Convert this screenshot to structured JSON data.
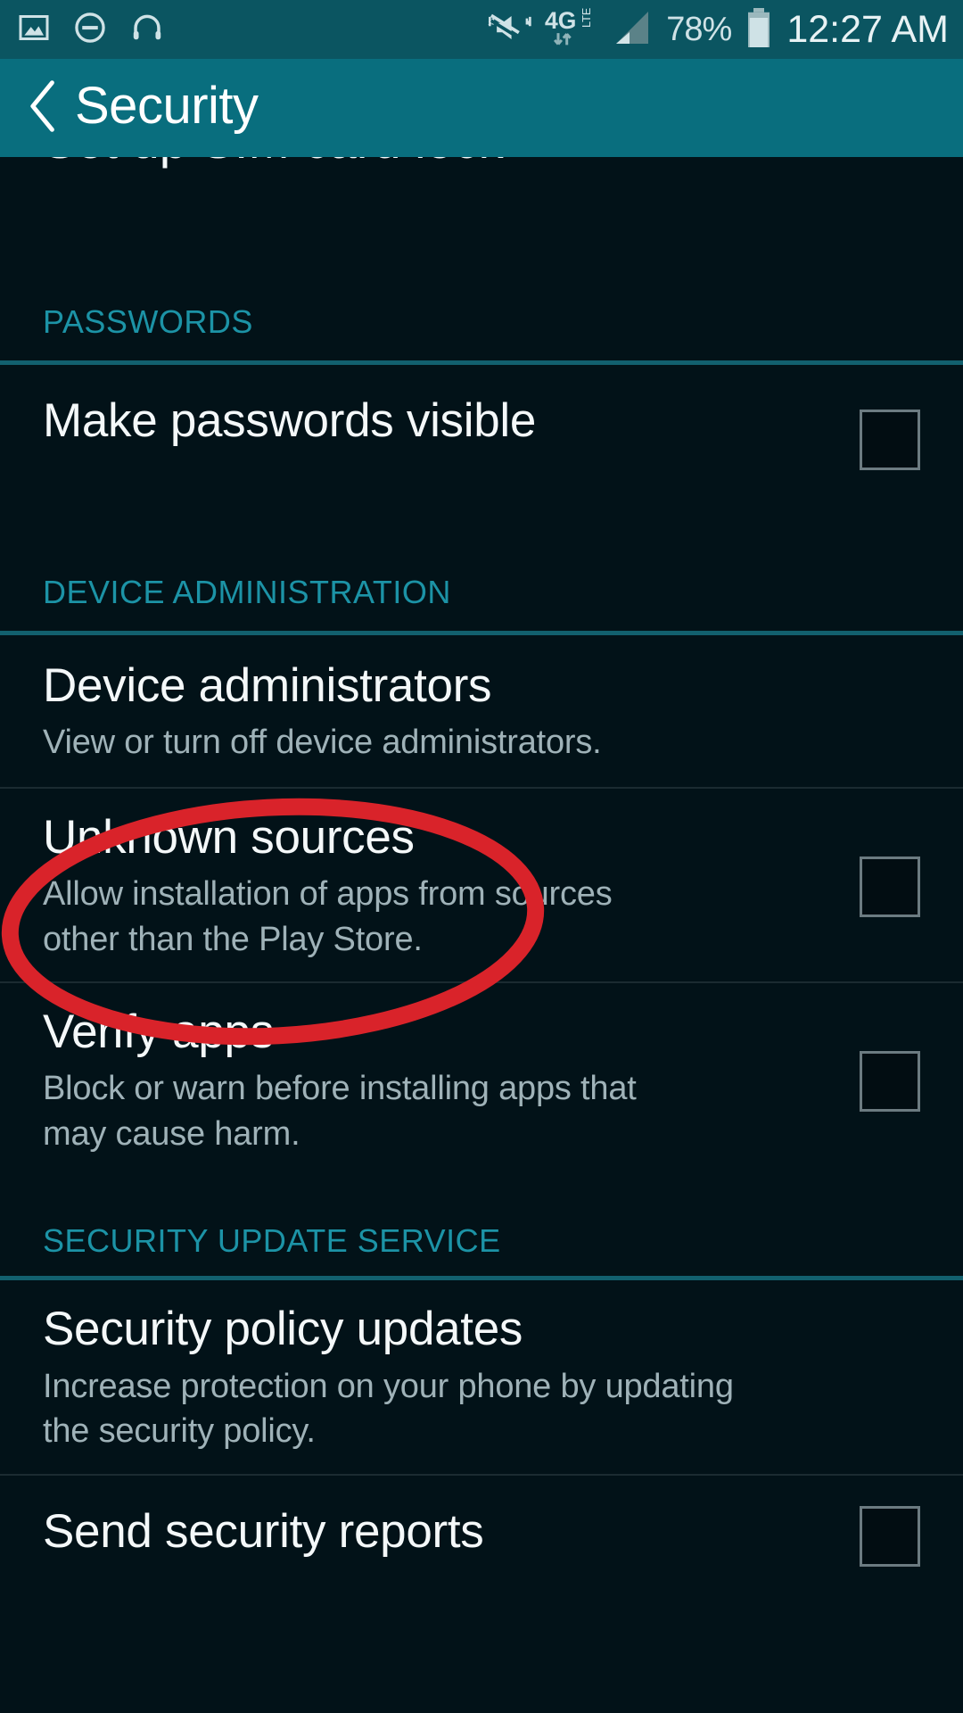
{
  "status_bar": {
    "icons_left": [
      "image-icon",
      "do-not-disturb-icon",
      "headphones-icon"
    ],
    "icons_right": [
      "mute-vibrate-icon",
      "4g-lte-icon",
      "signal-bars-icon"
    ],
    "network_label": "4G",
    "network_sub_label": "LTE",
    "battery_percent": "78%",
    "time": "12:27 AM"
  },
  "app_bar": {
    "back_icon": "chevron-left-icon",
    "title": "Security"
  },
  "list": {
    "clipped_top_item": {
      "title": "Set up SIM card lock"
    },
    "sections": [
      {
        "header": "PASSWORDS",
        "items": [
          {
            "title": "Make passwords visible",
            "subtitle": "",
            "control": "checkbox",
            "checked": false
          }
        ]
      },
      {
        "header": "DEVICE ADMINISTRATION",
        "items": [
          {
            "title": "Device administrators",
            "subtitle": "View or turn off device administrators.",
            "control": "none",
            "checked": false
          },
          {
            "title": "Unknown sources",
            "subtitle": "Allow installation of apps from sources other than the Play Store.",
            "control": "checkbox",
            "checked": false
          },
          {
            "title": "Verify apps",
            "subtitle": "Block or warn before installing apps that may cause harm.",
            "control": "checkbox",
            "checked": false
          }
        ]
      },
      {
        "header": "SECURITY UPDATE SERVICE",
        "items": [
          {
            "title": "Security policy updates",
            "subtitle": "Increase protection on your phone by updating the security policy.",
            "control": "none",
            "checked": false
          },
          {
            "title": "Send security reports",
            "subtitle": "",
            "control": "checkbox",
            "checked": false
          }
        ]
      }
    ]
  },
  "annotation": {
    "shape": "ellipse",
    "color": "#d9232a",
    "target_label": "Unknown sources"
  },
  "colors": {
    "background": "#021218",
    "status_bar": "#0b5561",
    "app_bar": "#096e7e",
    "section_header_text": "#1c93a6",
    "divider_teal": "#12606e",
    "divider_thin": "#1b2b31",
    "primary_text": "#f4f8f9",
    "secondary_text": "#9fb2b8",
    "checkbox_border": "#6c7b81",
    "annotation_red": "#d9232a"
  }
}
